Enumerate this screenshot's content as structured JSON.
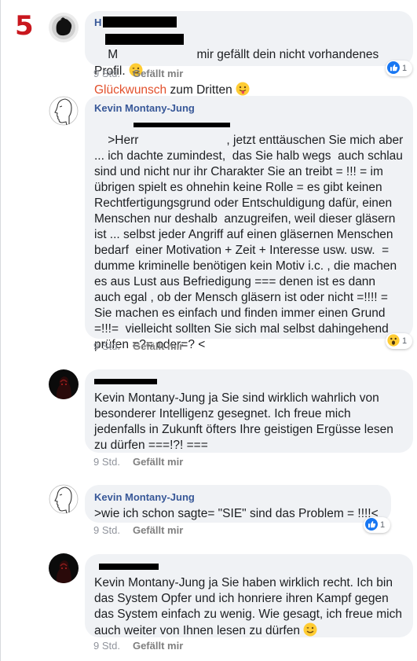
{
  "annotation": {
    "number": "5"
  },
  "comments": [
    {
      "author": "H",
      "text_prefix": "M",
      "text_main": " mir gefällt dein nicht vorhandenes Profil.",
      "emoji_1": "wink-emoji",
      "text_link": "Glückwunsch",
      "text_after": " zum Dritten",
      "emoji_2": "tongue-emoji",
      "time": "9 Std.",
      "like": "Gefällt mir",
      "reaction_icon": "like-icon",
      "reaction_count": "1"
    },
    {
      "author": "Kevin Montany-Jung",
      "text": ">Herr                          , jetzt enttäuschen Sie mich aber ... ich dachte zumindest,  das Sie halb wegs  auch schlau sind und nicht nur ihr Charakter Sie an treibt = !!! = im übrigen spielt es ohnehin keine Rolle = es gibt keinen Rechtfertigungsgrund oder Entschuldigung dafür, einen Menschen nur deshalb  anzugreifen, weil dieser gläsern ist ... selbst jeder Angriff auf einen gläsernen Menschen bedarf  einer Motivation + Zeit + Interesse usw. usw.  = dumme kriminelle benötigen kein Motiv i.c. , die machen es aus Lust aus Befriedigung === denen ist es dann auch egal , ob der Mensch gläsern ist oder nicht =!!!! = Sie machen es einfach und finden immer einen Grund =!!!=  vielleicht sollten Sie sich mal selbst dahingehend prüfen =?= oder=? <",
      "time": "9 Std.",
      "like": "Gefällt mir",
      "reaction_icon": "wow-emoji",
      "reaction_count": "1"
    },
    {
      "author": "",
      "text": "Kevin Montany-Jung ja Sie sind wirklich wahrlich von besonderer Intelligenz gesegnet. Ich freue mich jedenfalls in Zukunft öfters Ihre geistigen Ergüsse lesen zu dürfen ===!?! ===",
      "time": "9 Std.",
      "like": "Gefällt mir"
    },
    {
      "author": "Kevin Montany-Jung",
      "text": ">wie ich schon sagte= \"SIE\" sind das Problem = !!!!<",
      "time": "9 Std.",
      "like": "Gefällt mir",
      "reaction_icon": "like-icon",
      "reaction_count": "1"
    },
    {
      "author": "",
      "text": "Kevin Montany-Jung ja Sie haben wirklich recht. Ich bin das System Opfer und ich honriere ihren Kampf gegen das System einfach zu wenig. Wie gesagt, ich freue mich auch weiter von Ihnen lesen zu dürfen",
      "emoji": "wink-emoji",
      "time": "9 Std.",
      "like": "Gefällt mir"
    }
  ],
  "colors": {
    "bubble": "#f0f2f5",
    "author": "#385898",
    "meta": "#90949c",
    "accent_link": "#e2502c",
    "annotation": "#c9171e"
  }
}
